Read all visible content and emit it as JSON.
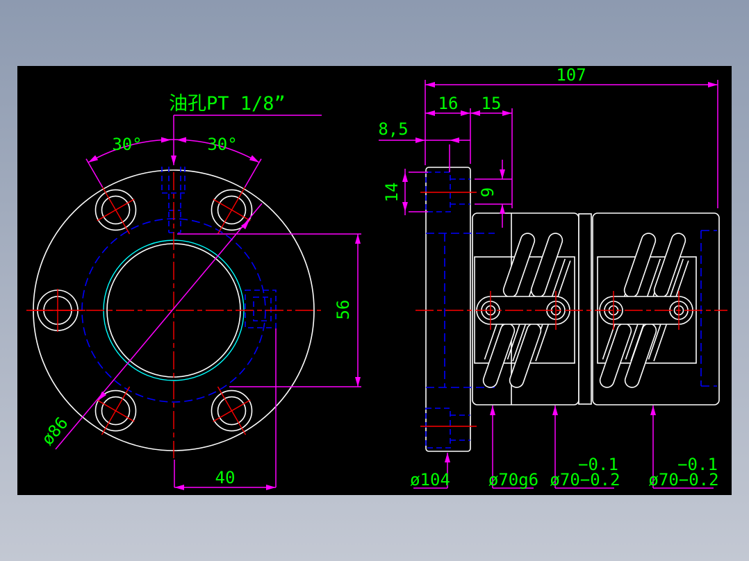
{
  "colors": {
    "background_top": "#8d9ab0",
    "background_bottom": "#c3c8d3",
    "canvas": "#000000",
    "geometry": "#ffffff",
    "hidden": "#0000ff",
    "center": "#ff0000",
    "dimension": "#ff00ff",
    "text": "#00ff00",
    "thread": "#00ffff"
  },
  "note": {
    "oil_hole": "油孔PT 1/8”"
  },
  "front_view": {
    "angle_left": "30°",
    "angle_right": "30°",
    "bolt_circle_diameter": "ø86",
    "bolt_spacing": "40",
    "across_flats": "56"
  },
  "side_view": {
    "overall_length": "107",
    "flange_thickness": "16",
    "seal_section": "15",
    "oil_hole_offset": "8,5",
    "boss_width": "14",
    "oil_hole_diameter": "9"
  },
  "diameter_labels": [
    {
      "value": "ø104",
      "tolerance": ""
    },
    {
      "value": "ø70g6",
      "tolerance": ""
    },
    {
      "value": "ø70−0.2",
      "tolerance": "−0.1"
    },
    {
      "value": "ø70−0.2",
      "tolerance": "−0.1"
    }
  ]
}
